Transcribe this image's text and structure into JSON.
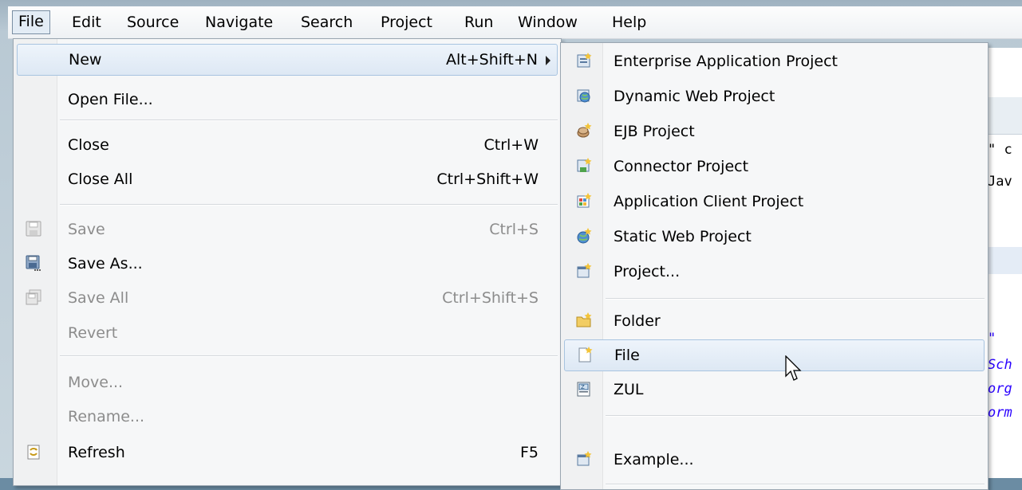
{
  "menubar": {
    "items": [
      "File",
      "Edit",
      "Source",
      "Navigate",
      "Search",
      "Project",
      "Run",
      "Window",
      "Help"
    ]
  },
  "file_menu": {
    "items": [
      {
        "label": "New",
        "shortcut": "Alt+Shift+N",
        "submenu": true,
        "state": "highlighted"
      },
      {
        "label": "Open File...",
        "shortcut": "",
        "state": "enabled"
      },
      {
        "label": "Close",
        "shortcut": "Ctrl+W",
        "state": "enabled"
      },
      {
        "label": "Close All",
        "shortcut": "Ctrl+Shift+W",
        "state": "enabled"
      },
      {
        "label": "Save",
        "shortcut": "Ctrl+S",
        "state": "disabled",
        "icon": "save-icon"
      },
      {
        "label": "Save As...",
        "shortcut": "",
        "state": "enabled",
        "icon": "save-as-icon"
      },
      {
        "label": "Save All",
        "shortcut": "Ctrl+Shift+S",
        "state": "disabled",
        "icon": "save-all-icon"
      },
      {
        "label": "Revert",
        "shortcut": "",
        "state": "disabled"
      },
      {
        "label": "Move...",
        "shortcut": "",
        "state": "disabled"
      },
      {
        "label": "Rename...",
        "shortcut": "",
        "state": "disabled"
      },
      {
        "label": "Refresh",
        "shortcut": "F5",
        "state": "enabled",
        "icon": "refresh-icon"
      }
    ]
  },
  "new_menu": {
    "items": [
      {
        "label": "Enterprise Application Project",
        "icon": "enterprise-app-project-icon"
      },
      {
        "label": "Dynamic Web Project",
        "icon": "dynamic-web-project-icon"
      },
      {
        "label": "EJB Project",
        "icon": "ejb-project-icon"
      },
      {
        "label": "Connector Project",
        "icon": "connector-project-icon"
      },
      {
        "label": "Application Client Project",
        "icon": "app-client-project-icon"
      },
      {
        "label": "Static Web Project",
        "icon": "static-web-project-icon"
      },
      {
        "label": "Project...",
        "icon": "project-icon"
      },
      {
        "label": "Folder",
        "icon": "folder-icon"
      },
      {
        "label": "File",
        "icon": "new-file-icon",
        "state": "hover"
      },
      {
        "label": "ZUL",
        "icon": "zul-file-icon"
      },
      {
        "label": "Example...",
        "icon": "example-icon"
      }
    ]
  },
  "editor_peek": {
    "lines": [
      "\" c",
      "Jav",
      "\"",
      "Sch",
      "org",
      "orm"
    ]
  },
  "colors": {
    "menu_bg": "#f6f7f8",
    "highlight": "#dde8f4",
    "disabled_text": "#8c8c8c",
    "string_text": "#2a00ff"
  }
}
